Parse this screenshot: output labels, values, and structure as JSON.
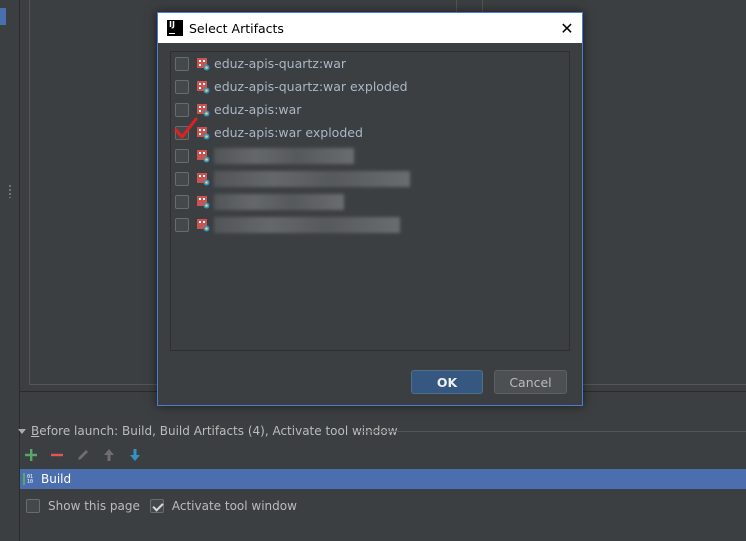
{
  "dialog": {
    "title": "Select Artifacts",
    "close_glyph": "✕",
    "artifacts": [
      {
        "label": "eduz-apis-quartz:war",
        "checked": false
      },
      {
        "label": "eduz-apis-quartz:war exploded",
        "checked": false
      },
      {
        "label": "eduz-apis:war",
        "checked": false
      },
      {
        "label": "eduz-apis:war exploded",
        "checked": true
      },
      {
        "label": "",
        "checked": false,
        "blurred": true
      },
      {
        "label": "",
        "checked": false,
        "blurred": true
      },
      {
        "label": "",
        "checked": false,
        "blurred": true
      },
      {
        "label": "",
        "checked": false,
        "blurred": true
      }
    ],
    "ok_label": "OK",
    "cancel_label": "Cancel"
  },
  "before_launch": {
    "prefix": "B",
    "text": "efore launch: Build, Build Artifacts (4), Activate tool window"
  },
  "tasks": [
    {
      "label": "Build"
    }
  ],
  "options": {
    "show_page": {
      "label": "Show this page",
      "checked": false
    },
    "activate_tool_window": {
      "label": "Activate tool window",
      "checked": true
    }
  },
  "colors": {
    "accent": "#4b6eaf",
    "ok_button": "#365880",
    "background": "#3c3f41"
  }
}
